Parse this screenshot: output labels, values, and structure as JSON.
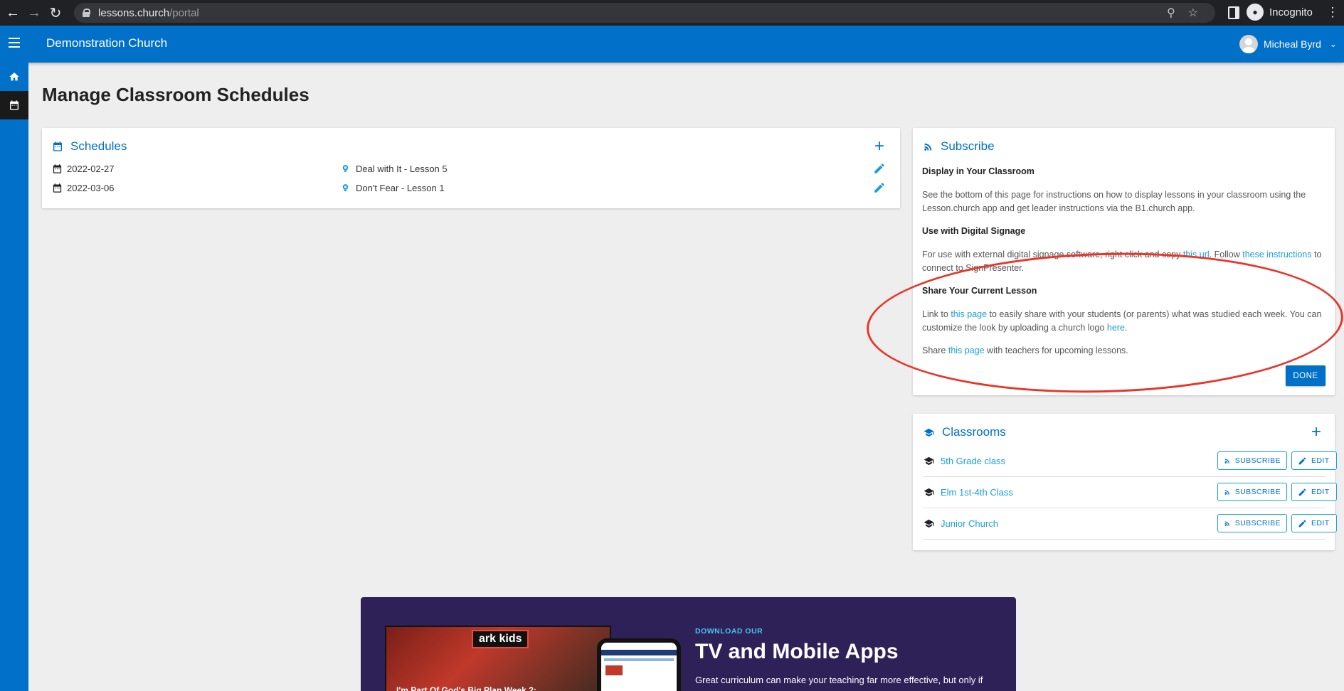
{
  "browser": {
    "url_host": "lessons.church",
    "url_path": "/portal",
    "profile_label": "Incognito"
  },
  "header": {
    "church_name": "Demonstration Church",
    "user_name": "Micheal Byrd"
  },
  "page": {
    "title": "Manage Classroom Schedules"
  },
  "schedules": {
    "title": "Schedules",
    "rows": [
      {
        "date": "2022-02-27",
        "lesson": "Deal with It - Lesson 5"
      },
      {
        "date": "2022-03-06",
        "lesson": "Don't Fear - Lesson 1"
      }
    ]
  },
  "subscribe": {
    "title": "Subscribe",
    "display_heading": "Display in Your Classroom",
    "display_text": "See the bottom of this page for instructions on how to display lessons in your classroom using the Lesson.church app and get leader instructions via the B1.church app.",
    "signage_heading": "Use with Digital Signage",
    "signage_text_1": "For use with external digital signage software, right click and copy ",
    "signage_link_1": "this url",
    "signage_text_2": ". Follow ",
    "signage_link_2": "these instructions",
    "signage_text_3": " to connect to SignPresenter.",
    "share_heading": "Share Your Current Lesson",
    "share_text_1": "Link to ",
    "share_link_1": "this page",
    "share_text_2": " to easily share with your students (or parents) what was studied each week. You can customize the look by uploading a church logo ",
    "share_link_2": "here",
    "share_text_3": ".",
    "share2_text_1": "Share ",
    "share2_link": "this page",
    "share2_text_2": " with teachers for upcoming lessons.",
    "done_label": "DONE"
  },
  "classrooms": {
    "title": "Classrooms",
    "subscribe_label": "SUBSCRIBE",
    "edit_label": "EDIT",
    "rows": [
      {
        "name": "5th Grade class"
      },
      {
        "name": "Elm 1st-4th Class"
      },
      {
        "name": "Junior Church"
      }
    ]
  },
  "promo": {
    "image_caption": "I'm Part Of God's Big Plan Week 2:",
    "logo_text": "ark kids",
    "kicker": "DOWNLOAD OUR",
    "title": "TV and Mobile Apps",
    "text": "Great curriculum can make your teaching far more effective, but only if"
  },
  "colors": {
    "primary": "#0070c9",
    "link": "#1a9fd6",
    "annotation": "#e8362a",
    "promo_bg": "#2d2158"
  }
}
